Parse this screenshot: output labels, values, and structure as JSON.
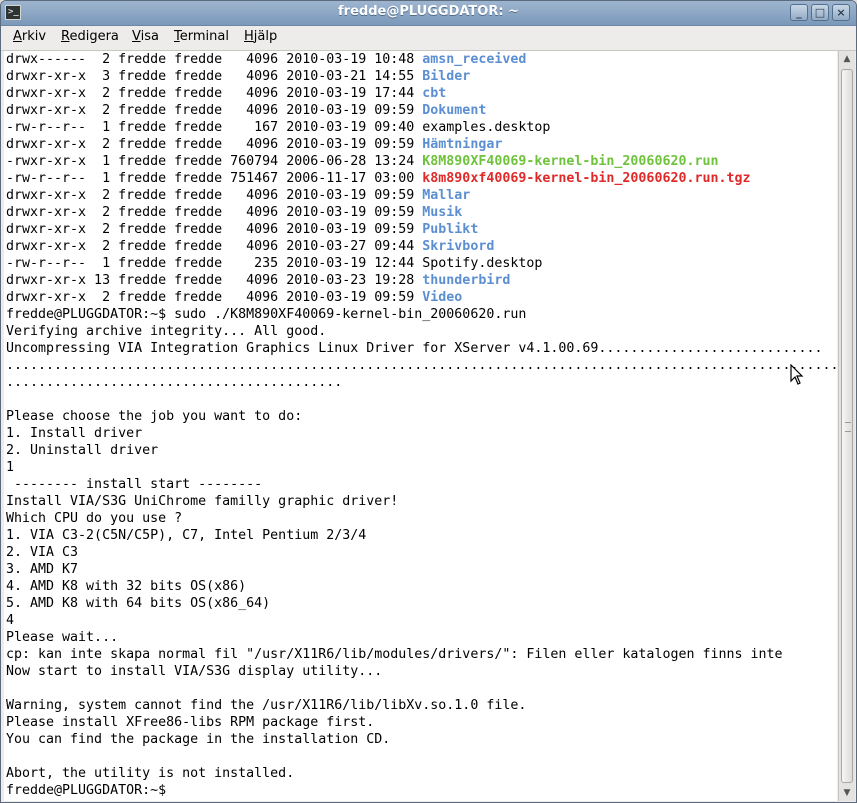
{
  "window": {
    "title": "fredde@PLUGGDATOR: ~",
    "icon": "terminal-icon",
    "controls": [
      "minimize",
      "maximize",
      "close"
    ]
  },
  "menubar": {
    "items": [
      {
        "label": "Arkiv",
        "mnemonic": "A",
        "rest": "rkiv"
      },
      {
        "label": "Redigera",
        "mnemonic": "R",
        "rest": "edigera"
      },
      {
        "label": "Visa",
        "mnemonic": "V",
        "rest": "isa"
      },
      {
        "label": "Terminal",
        "mnemonic": "T",
        "rest": "erminal"
      },
      {
        "label": "Hjälp",
        "mnemonic": "H",
        "rest": "jälp"
      }
    ]
  },
  "colors": {
    "directory": "#5b8fd2",
    "executable": "#6ec23c",
    "archive": "#e02a2a",
    "text": "#000000",
    "background": "#ffffff"
  },
  "listing": [
    {
      "meta": "drwx------  2 fredde fredde   4096 2010-03-19 10:48 ",
      "name": "amsn_received",
      "kind": "dir"
    },
    {
      "meta": "drwxr-xr-x  3 fredde fredde   4096 2010-03-21 14:55 ",
      "name": "Bilder",
      "kind": "dir"
    },
    {
      "meta": "drwxr-xr-x  2 fredde fredde   4096 2010-03-19 17:44 ",
      "name": "cbt",
      "kind": "dir"
    },
    {
      "meta": "drwxr-xr-x  2 fredde fredde   4096 2010-03-19 09:59 ",
      "name": "Dokument",
      "kind": "dir"
    },
    {
      "meta": "-rw-r--r--  1 fredde fredde    167 2010-03-19 09:40 ",
      "name": "examples.desktop",
      "kind": "file"
    },
    {
      "meta": "drwxr-xr-x  2 fredde fredde   4096 2010-03-19 09:59 ",
      "name": "Hämtningar",
      "kind": "dir"
    },
    {
      "meta": "-rwxr-xr-x  1 fredde fredde 760794 2006-06-28 13:24 ",
      "name": "K8M890XF40069-kernel-bin_20060620.run",
      "kind": "exe"
    },
    {
      "meta": "-rw-r--r--  1 fredde fredde 751467 2006-11-17 03:00 ",
      "name": "k8m890xf40069-kernel-bin_20060620.run.tgz",
      "kind": "arc"
    },
    {
      "meta": "drwxr-xr-x  2 fredde fredde   4096 2010-03-19 09:59 ",
      "name": "Mallar",
      "kind": "dir"
    },
    {
      "meta": "drwxr-xr-x  2 fredde fredde   4096 2010-03-19 09:59 ",
      "name": "Musik",
      "kind": "dir"
    },
    {
      "meta": "drwxr-xr-x  2 fredde fredde   4096 2010-03-19 09:59 ",
      "name": "Publikt",
      "kind": "dir"
    },
    {
      "meta": "drwxr-xr-x  2 fredde fredde   4096 2010-03-27 09:44 ",
      "name": "Skrivbord",
      "kind": "dir"
    },
    {
      "meta": "-rw-r--r--  1 fredde fredde    235 2010-03-19 12:44 ",
      "name": "Spotify.desktop",
      "kind": "file"
    },
    {
      "meta": "drwxr-xr-x 13 fredde fredde   4096 2010-03-23 19:28 ",
      "name": "thunderbird",
      "kind": "dir"
    },
    {
      "meta": "drwxr-xr-x  2 fredde fredde   4096 2010-03-19 09:59 ",
      "name": "Video",
      "kind": "dir"
    }
  ],
  "output": [
    "fredde@PLUGGDATOR:~$ sudo ./K8M890XF40069-kernel-bin_20060620.run",
    "Verifying archive integrity... All good.",
    "Uncompressing VIA Integration Graphics Linux Driver for XServer v4.1.00.69............................",
    "..........................................................................................................",
    "..........................................",
    "",
    "Please choose the job you want to do:",
    "1. Install driver",
    "2. Uninstall driver",
    "1",
    " -------- install start --------",
    "Install VIA/S3G UniChrome familly graphic driver!",
    "Which CPU do you use ?",
    "1. VIA C3-2(C5N/C5P), C7, Intel Pentium 2/3/4",
    "2. VIA C3",
    "3. AMD K7",
    "4. AMD K8 with 32 bits OS(x86)",
    "5. AMD K8 with 64 bits OS(x86_64)",
    "4",
    "Please wait...",
    "cp: kan inte skapa normal fil \"/usr/X11R6/lib/modules/drivers/\": Filen eller katalogen finns inte",
    "Now start to install VIA/S3G display utility...",
    "",
    "Warning, system cannot find the /usr/X11R6/lib/libXv.so.1.0 file.",
    "Please install XFree86-libs RPM package first.",
    "You can find the package in the installation CD.",
    "",
    "Abort, the utility is not installed.",
    "fredde@PLUGGDATOR:~$ "
  ]
}
